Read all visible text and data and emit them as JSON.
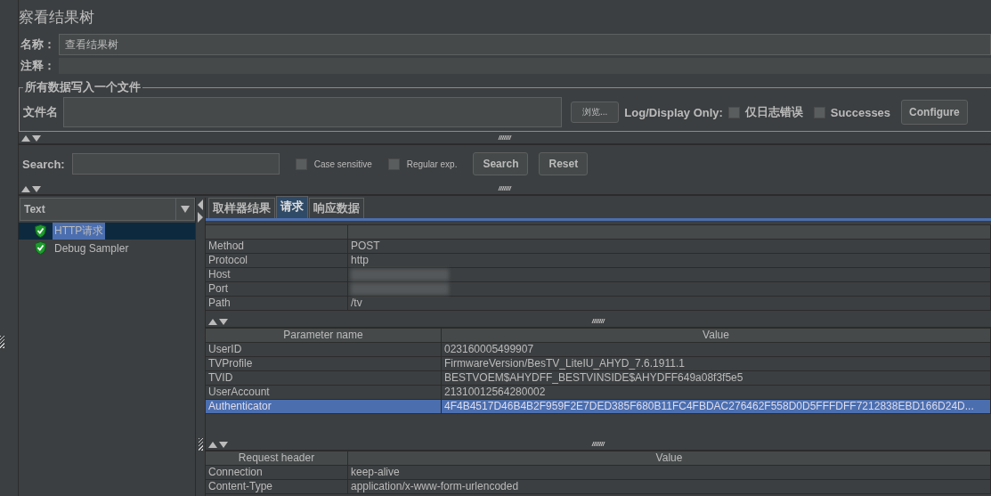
{
  "title": "察看结果树",
  "name_field": {
    "label": "名称：",
    "value": "查看结果树"
  },
  "comment_field": {
    "label": "注释："
  },
  "file_group": {
    "legend": "所有数据写入一个文件",
    "filename_label": "文件名",
    "browse_button": "浏览...",
    "log_label": "Log/Display Only:",
    "checkboxes": [
      {
        "label": "仅日志错误",
        "checked": false
      },
      {
        "label": "Successes",
        "checked": false
      }
    ],
    "configure_button": "Configure"
  },
  "search": {
    "label": "Search:",
    "options": [
      {
        "label": "Case sensitive",
        "checked": false
      },
      {
        "label": "Regular exp.",
        "checked": false
      }
    ],
    "buttons": [
      "Search",
      "Reset"
    ]
  },
  "renderer": {
    "value": "Text"
  },
  "tree": [
    {
      "label": "HTTP请求",
      "selected": true
    },
    {
      "label": "Debug Sampler",
      "selected": false
    }
  ],
  "tabs": [
    {
      "label": "取样器结果",
      "selected": false
    },
    {
      "label": "请求",
      "selected": true
    },
    {
      "label": "响应数据",
      "selected": false
    }
  ],
  "request_table": {
    "rows": [
      {
        "name": "Method",
        "value": "POST"
      },
      {
        "name": "Protocol",
        "value": "http"
      },
      {
        "name": "Host"
      },
      {
        "name": "Port"
      },
      {
        "name": "Path",
        "value": "/tv"
      }
    ]
  },
  "parameters": {
    "columns": [
      "Parameter name",
      "Value"
    ],
    "rows": [
      {
        "name": "UserID",
        "value": "023160005499907",
        "selected": false
      },
      {
        "name": "TVProfile",
        "value": "FirmwareVersion/BesTV_LiteIU_AHYD_7.6.1911.1",
        "selected": false
      },
      {
        "name": "TVID",
        "value": "BESTVOEM$AHYDFF_BESTVINSIDE$AHYDFF649a08f3f5e5",
        "selected": false
      },
      {
        "name": "UserAccount",
        "value": "21310012564280002",
        "selected": false
      },
      {
        "name": "Authenticator",
        "value": "4F4B4517D46B4B2F959F2E7DED385F680B11FC4FBDAC276462F558D0D5FFFDFF7212838EBD166D24D...",
        "selected": true
      }
    ]
  },
  "headers": {
    "columns": [
      "Request header",
      "Value"
    ],
    "rows": [
      {
        "name": "Connection",
        "value": "keep-alive"
      },
      {
        "name": "Content-Type",
        "value": "application/x-www-form-urlencoded"
      }
    ]
  }
}
